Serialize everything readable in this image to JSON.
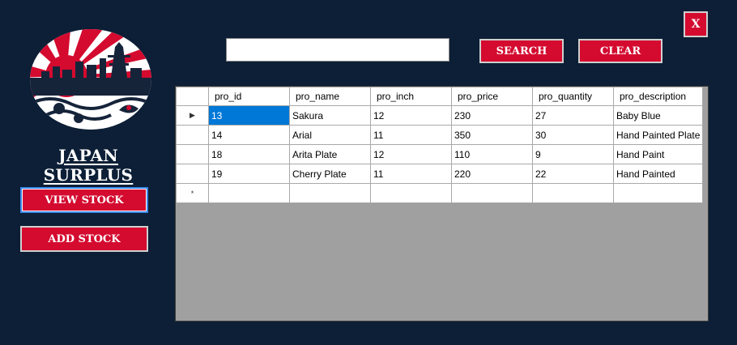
{
  "app": {
    "brand": "JAPAN SURPLUS"
  },
  "sidebar": {
    "view_stock": "VIEW STOCK",
    "add_stock": "ADD STOCK"
  },
  "toolbar": {
    "search_value": "",
    "search_label": "SEARCH",
    "clear_label": "CLEAR",
    "close_label": "X"
  },
  "grid": {
    "columns": [
      "pro_id",
      "pro_name",
      "pro_inch",
      "pro_price",
      "pro_quantity",
      "pro_description"
    ],
    "rows": [
      {
        "indicator": "▶",
        "cells": [
          "13",
          "Sakura",
          "12",
          "230",
          "27",
          "Baby Blue"
        ]
      },
      {
        "indicator": "",
        "cells": [
          "14",
          "Arial",
          "11",
          "350",
          "30",
          "Hand Painted Plate"
        ]
      },
      {
        "indicator": "",
        "cells": [
          "18",
          "Arita Plate",
          "12",
          "110",
          "9",
          "Hand Paint"
        ]
      },
      {
        "indicator": "",
        "cells": [
          "19",
          "Cherry Plate",
          "11",
          "220",
          "22",
          "Hand Painted"
        ]
      }
    ],
    "new_row_indicator": "*"
  },
  "colors": {
    "background": "#0c1f36",
    "button_red": "#d40a2f",
    "selection_blue": "#0078d7",
    "grid_empty": "#a0a0a0"
  }
}
